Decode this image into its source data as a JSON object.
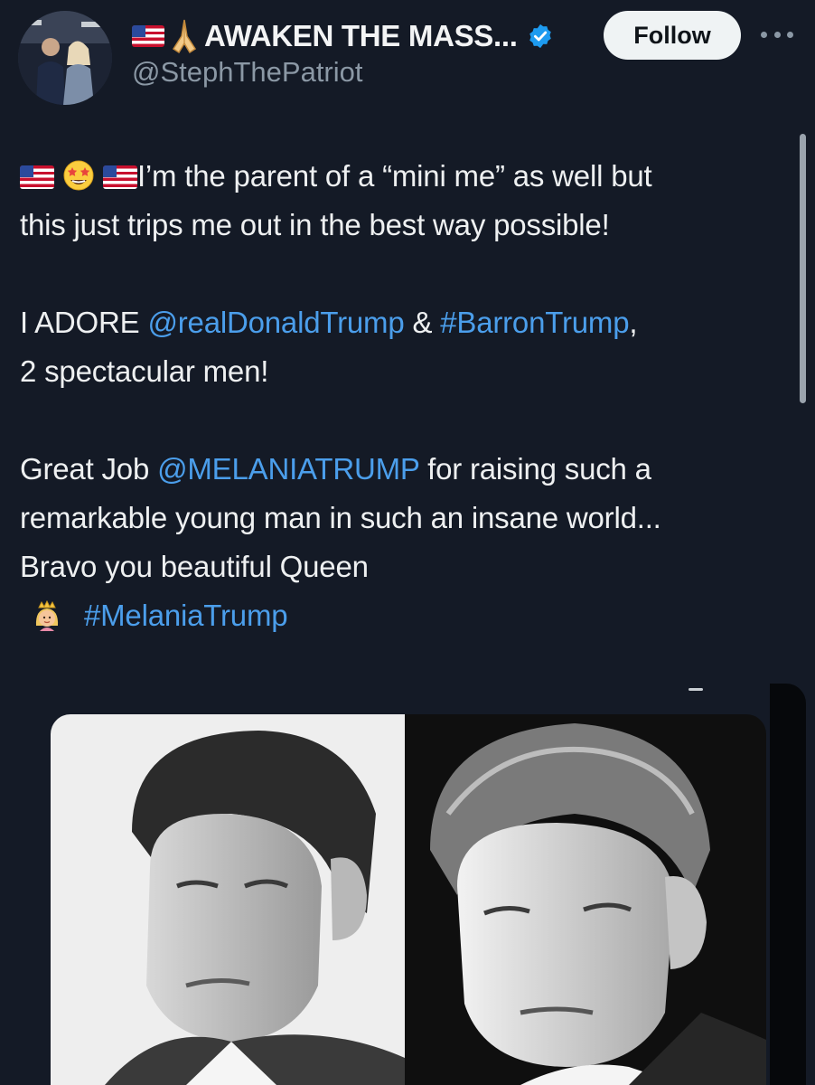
{
  "author": {
    "display_name": "AWAKEN THE MASS...",
    "handle": "@StephThePatriot",
    "verified": true,
    "avatar_icon": "profile-photo"
  },
  "actions": {
    "follow_label": "Follow",
    "more_icon": "more-horizontal-icon"
  },
  "post": {
    "line1_text": "I’m the parent of a “mini me” as well but",
    "line2_text": "this just trips me out in the best way possible!",
    "adore_prefix": "I ADORE ",
    "mention_trump": "@realDonaldTrump",
    "amp": " & ",
    "hashtag_barron": "#BarronTrump",
    "comma": ",",
    "men_text": "2 spectacular men!",
    "great_job": "Great Job ",
    "mention_melania": "@MELANIATRUMP",
    "raising_text": " for raising such a",
    "remarkable_text": "remarkable young man in such an insane world...",
    "bravo_text": "Bravo you beautiful Queen",
    "hashtag_melania": "#MelaniaTrump"
  },
  "media": {
    "left_image": "black-and-white portrait of young man with swept hair",
    "right_image": "black-and-white portrait of teenage young man"
  },
  "colors": {
    "background": "#141a26",
    "link": "#4b9eeb",
    "verified": "#1d9bf0",
    "text": "#eef0f1",
    "muted": "#8b98a5"
  }
}
